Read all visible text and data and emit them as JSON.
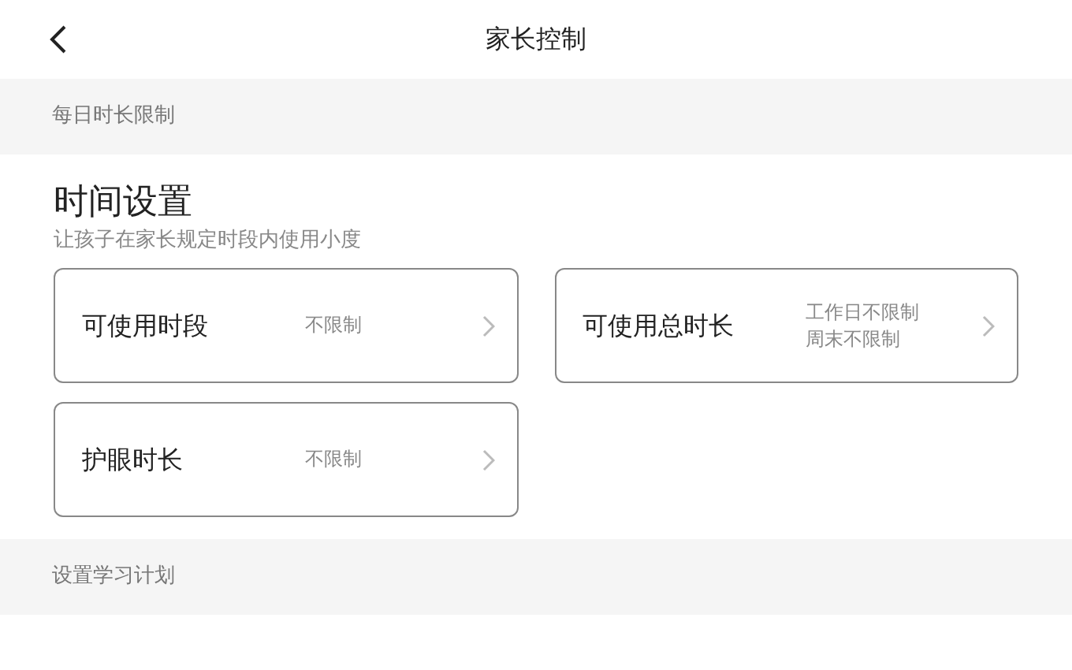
{
  "header": {
    "title": "家长控制"
  },
  "sections": [
    {
      "heading": "每日时长限制",
      "title": "时间设置",
      "subtitle": "让孩子在家长规定时段内使用小度",
      "cards": [
        {
          "label": "可使用时段",
          "values": [
            "不限制"
          ]
        },
        {
          "label": "可使用总时长",
          "values": [
            "工作日不限制",
            "周末不限制"
          ]
        },
        {
          "label": "护眼时长",
          "values": [
            "不限制"
          ]
        }
      ]
    },
    {
      "heading": "设置学习计划"
    }
  ]
}
